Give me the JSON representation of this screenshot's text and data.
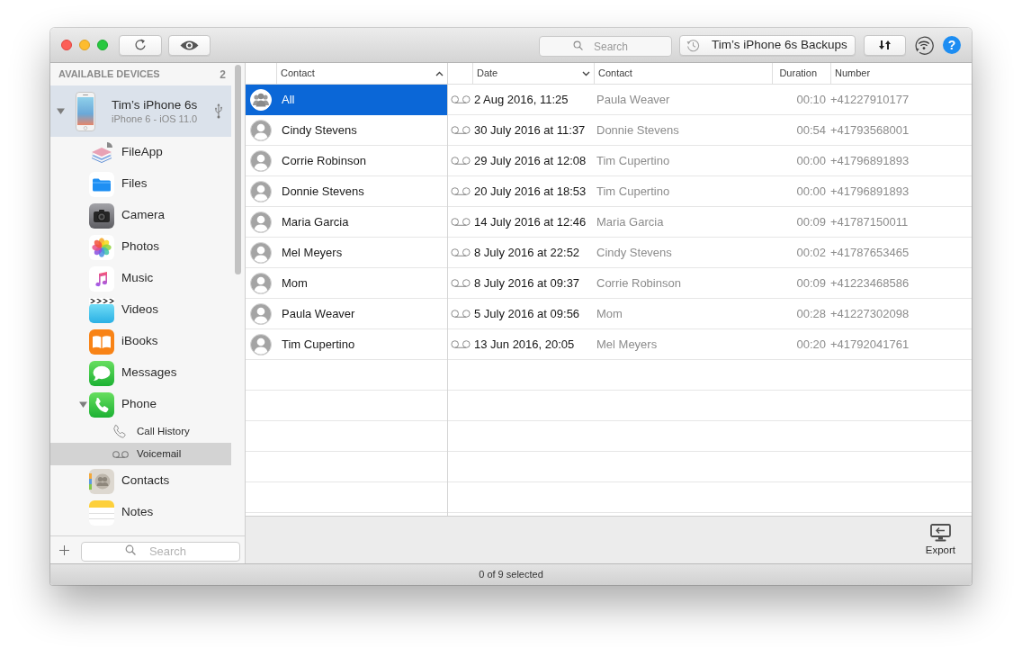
{
  "toolbar": {
    "search": {
      "placeholder": "Search"
    },
    "backups_button": {
      "label": "Tim’s iPhone 6s Backups"
    },
    "help_button": {
      "label": "?"
    }
  },
  "sidebar": {
    "header": {
      "title": "AVAILABLE DEVICES",
      "count": "2"
    },
    "devices": [
      {
        "name": "Tim’s iPhone 6s",
        "model": "iPhone 6 - iOS 11.0",
        "selected": true,
        "expanded": true,
        "children": [
          {
            "label": "FileApp",
            "kind": "fileapp",
            "selected": false
          },
          {
            "label": "Files",
            "kind": "files",
            "selected": false
          },
          {
            "label": "Camera",
            "kind": "camera",
            "selected": false
          },
          {
            "label": "Photos",
            "kind": "photos",
            "selected": false
          },
          {
            "label": "Music",
            "kind": "music",
            "selected": false
          },
          {
            "label": "Videos",
            "kind": "videos",
            "selected": false
          },
          {
            "label": "iBooks",
            "kind": "ibooks",
            "selected": false
          },
          {
            "label": "Messages",
            "kind": "messages",
            "selected": false
          },
          {
            "label": "Phone",
            "kind": "phone",
            "selected": false,
            "expanded": true,
            "children": [
              {
                "label": "Call History",
                "kind": "calls",
                "selected": false
              },
              {
                "label": "Voicemail",
                "kind": "voicemail",
                "selected": true
              }
            ]
          },
          {
            "label": "Contacts",
            "kind": "contacts",
            "selected": false
          },
          {
            "label": "Notes",
            "kind": "notes",
            "selected": false
          }
        ]
      }
    ],
    "search": {
      "placeholder": "Search"
    }
  },
  "contacts": {
    "column": {
      "label": "Contact",
      "sorted": true,
      "ascending": true
    },
    "items": [
      {
        "name": "All",
        "kind": "group",
        "selected": true
      },
      {
        "name": "Cindy Stevens",
        "kind": "person",
        "selected": false
      },
      {
        "name": "Corrie Robinson",
        "kind": "person",
        "selected": false
      },
      {
        "name": "Donnie Stevens",
        "kind": "person",
        "selected": false
      },
      {
        "name": "Maria Garcia",
        "kind": "person",
        "selected": false
      },
      {
        "name": "Mel Meyers",
        "kind": "person",
        "selected": false
      },
      {
        "name": "Mom",
        "kind": "person",
        "selected": false
      },
      {
        "name": "Paula Weaver",
        "kind": "person",
        "selected": false
      },
      {
        "name": "Tim Cupertino",
        "kind": "person",
        "selected": false
      }
    ]
  },
  "voicemail": {
    "columns": [
      {
        "label": "Date",
        "sorted": true,
        "ascending": false
      },
      {
        "label": "Contact",
        "sorted": false
      },
      {
        "label": "Duration",
        "sorted": false
      },
      {
        "label": "Number",
        "sorted": false
      }
    ],
    "rows": [
      {
        "date": "2 Aug 2016, 11:25",
        "contact": "Paula Weaver",
        "duration": "00:10",
        "number": "+41227910177"
      },
      {
        "date": "30 July 2016 at 11:37",
        "contact": "Donnie Stevens",
        "duration": "00:54",
        "number": "+41793568001"
      },
      {
        "date": "29 July 2016 at 12:08",
        "contact": "Tim Cupertino",
        "duration": "00:00",
        "number": "+41796891893"
      },
      {
        "date": "20 July 2016 at 18:53",
        "contact": "Tim Cupertino",
        "duration": "00:00",
        "number": "+41796891893"
      },
      {
        "date": "14 July 2016 at 12:46",
        "contact": "Maria Garcia",
        "duration": "00:09",
        "number": "+41787150011"
      },
      {
        "date": "8 July 2016 at 22:52",
        "contact": "Cindy Stevens",
        "duration": "00:02",
        "number": "+41787653465"
      },
      {
        "date": "8 July 2016 at 09:37",
        "contact": "Corrie Robinson",
        "duration": "00:09",
        "number": "+41223468586"
      },
      {
        "date": "5 July 2016 at 09:56",
        "contact": "Mom",
        "duration": "00:28",
        "number": "+41227302098"
      },
      {
        "date": "13 Jun 2016, 20:05",
        "contact": "Mel Meyers",
        "duration": "00:20",
        "number": "+41792041761"
      }
    ]
  },
  "actions": {
    "export_button": {
      "label": "Export"
    }
  },
  "status_bar": {
    "text": "0 of 9 selected"
  }
}
